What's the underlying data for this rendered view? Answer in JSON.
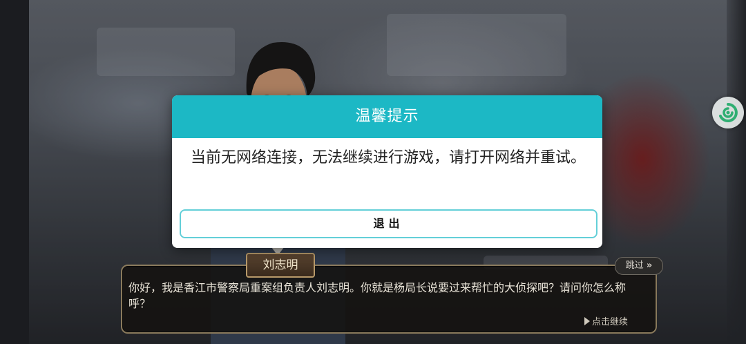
{
  "modal": {
    "title": "温馨提示",
    "message": "当前无网络连接，无法继续进行游戏，请打开网络并重试。",
    "exit_button_label": "退出",
    "header_color": "#1cb8c5",
    "button_border_color": "#63cfd8"
  },
  "dialogue": {
    "speaker_name": "刘志明",
    "text": "你好，我是香江市警察局重案组负责人刘志明。你就是杨局长说要过来帮忙的大侦探吧？请问你怎么称呼？",
    "skip_label": "跳过",
    "continue_label": "点击继续"
  },
  "side_button": {
    "icon": "game-assistant-icon"
  }
}
